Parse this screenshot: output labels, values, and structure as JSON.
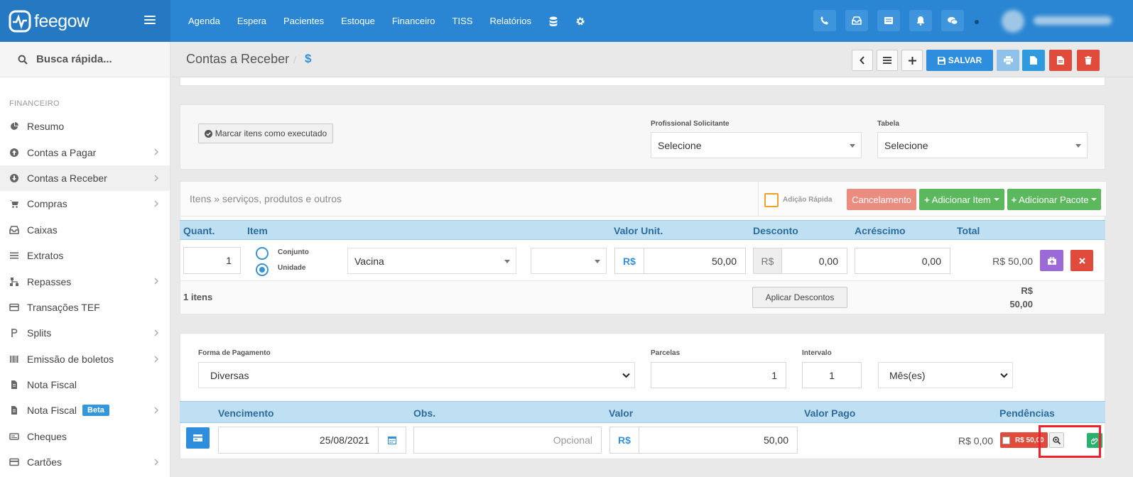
{
  "brand": {
    "name": "feegow"
  },
  "topnav": {
    "items": [
      "Agenda",
      "Espera",
      "Pacientes",
      "Estoque",
      "Financeiro",
      "TISS",
      "Relatórios"
    ]
  },
  "sidebar": {
    "search_placeholder": "Busca rápida...",
    "section": "FINANCEIRO",
    "items": [
      {
        "label": "Resumo",
        "icon": "pie-chart-icon"
      },
      {
        "label": "Contas a Pagar",
        "icon": "arrow-up-circle-icon"
      },
      {
        "label": "Contas a Receber",
        "icon": "arrow-down-circle-icon"
      },
      {
        "label": "Compras",
        "icon": "cart-icon"
      },
      {
        "label": "Caixas",
        "icon": "inbox-icon"
      },
      {
        "label": "Extratos",
        "icon": "list-icon"
      },
      {
        "label": "Repasses",
        "icon": "sitemap-icon"
      },
      {
        "label": "Transações TEF",
        "icon": "credit-card-icon"
      },
      {
        "label": "Splits",
        "icon": "split-icon"
      },
      {
        "label": "Emissão de boletos",
        "icon": "barcode-icon"
      },
      {
        "label": "Nota Fiscal",
        "icon": "document-icon"
      },
      {
        "label": "Nota Fiscal",
        "icon": "document-icon",
        "badge": "Beta"
      },
      {
        "label": "Cheques",
        "icon": "check-icon"
      },
      {
        "label": "Cartões",
        "icon": "credit-card-icon"
      }
    ]
  },
  "page": {
    "title": "Contas a Receber",
    "separator": "/",
    "currency_symbol": "$",
    "save_label": "SALVAR"
  },
  "top_form": {
    "mark_executed_label": "Marcar itens como executado",
    "professional_label": "Profissional Solicitante",
    "professional_value": "Selecione",
    "table_label": "Tabela",
    "table_value": "Selecione"
  },
  "items": {
    "header_text": "Itens » serviços, produtos e outros",
    "quick_add_label": "Adição Rápida",
    "cancel_label": "Cancelamento",
    "add_item_label": "Adicionar Item",
    "add_package_label": "Adicionar Pacote",
    "columns": [
      "Quant.",
      "Item",
      "Valor Unit.",
      "Desconto",
      "Acréscimo",
      "Total"
    ],
    "row": {
      "quantity": "1",
      "option_set": "Conjunto",
      "option_unit": "Unidade",
      "item": "Vacina",
      "currency": "R$",
      "unit_value": "50,00",
      "discount_currency": "R$",
      "discount": "0,00",
      "increase": "0,00",
      "total": "R$ 50,00"
    },
    "count_label": "1 itens",
    "apply_discounts_label": "Aplicar Descontos",
    "footer_total_currency": "R$",
    "footer_total_value": "50,00"
  },
  "payment": {
    "method_label": "Forma de Pagamento",
    "method_value": "Diversas",
    "installments_label": "Parcelas",
    "installments_value": "1",
    "interval_label": "Intervalo",
    "interval_value": "1",
    "interval_unit": "Mês(es)",
    "columns": [
      "Vencimento",
      "Obs.",
      "Valor",
      "Valor Pago",
      "Pendências"
    ],
    "row": {
      "due_date": "25/08/2021",
      "obs_placeholder": "Opcional",
      "currency": "R$",
      "value": "50,00",
      "paid": "R$ 0,00",
      "pending_badge": "R$ 50,00"
    }
  },
  "colors": {
    "primary": "#2a86d2",
    "success": "#5cb85c",
    "danger": "#e04b3b",
    "purple": "#9b6ad7",
    "highlight": "#f0212c"
  }
}
